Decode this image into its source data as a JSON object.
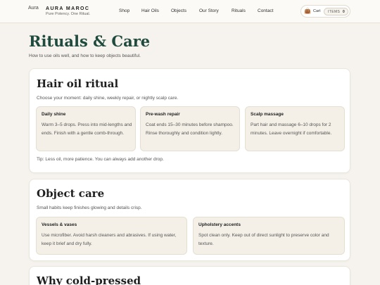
{
  "header": {
    "logo_alt": "Aura",
    "brand": "AURA MAROC",
    "tagline": "Pure Potency. One Ritual.",
    "nav": [
      {
        "label": "Shop"
      },
      {
        "label": "Hair Oils"
      },
      {
        "label": "Objects"
      },
      {
        "label": "Our Story"
      },
      {
        "label": "Rituals"
      },
      {
        "label": "Contact"
      }
    ],
    "cart": {
      "icon": "cart-icon",
      "label": "Cart",
      "items_label": "ITEMS",
      "count": "0"
    }
  },
  "page": {
    "title": "Rituals & Care",
    "subtitle": "How to use oils well, and how to keep objects beautiful."
  },
  "hair_ritual": {
    "title": "Hair oil ritual",
    "subtitle": "Choose your moment: daily shine, weekly repair, or nightly scalp care.",
    "tiles": [
      {
        "title": "Daily shine",
        "text": "Warm 3–5 drops. Press into mid-lengths and ends. Finish with a gentle comb-through."
      },
      {
        "title": "Pre-wash repair",
        "text": "Coat ends 15–30 minutes before shampoo. Rinse thoroughly and condition lightly."
      },
      {
        "title": "Scalp massage",
        "text": "Part hair and massage 6–10 drops for 2 minutes. Leave overnight if comfortable."
      }
    ],
    "tip": "Tip: Less oil, more patience. You can always add another drop."
  },
  "object_care": {
    "title": "Object care",
    "subtitle": "Small habits keep finishes glowing and details crisp.",
    "tiles": [
      {
        "title": "Vessels & vases",
        "text": "Use microfiber. Avoid harsh cleaners and abrasives. If using water, keep it brief and dry fully."
      },
      {
        "title": "Upholstery accents",
        "text": "Spot clean only. Keep out of direct sunlight to preserve color and texture."
      }
    ]
  },
  "cold_pressed": {
    "title": "Why cold-pressed"
  }
}
